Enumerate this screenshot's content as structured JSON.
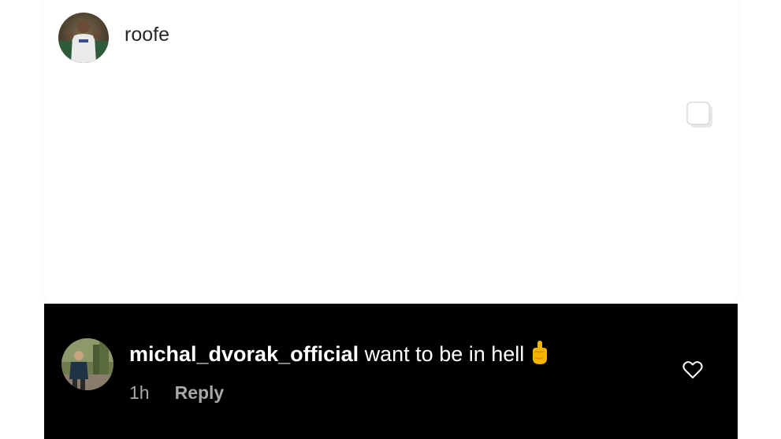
{
  "post": {
    "username": "roofe",
    "avatar_icon": "profile-photo-footballer"
  },
  "post_media": {
    "multi_icon": "carousel-icon"
  },
  "comment": {
    "username": "michal_dvorak_official",
    "text": "want to be in hell",
    "emoji": "middle-finger-emoji",
    "time": "1h",
    "reply_label": "Reply",
    "like_icon": "heart-outline-icon",
    "avatar_icon": "profile-photo-outdoor"
  },
  "colors": {
    "panel_bg": "#000000",
    "page_bg": "#ffffff",
    "meta_text": "#a8a8a8",
    "username_text": "#262626"
  }
}
